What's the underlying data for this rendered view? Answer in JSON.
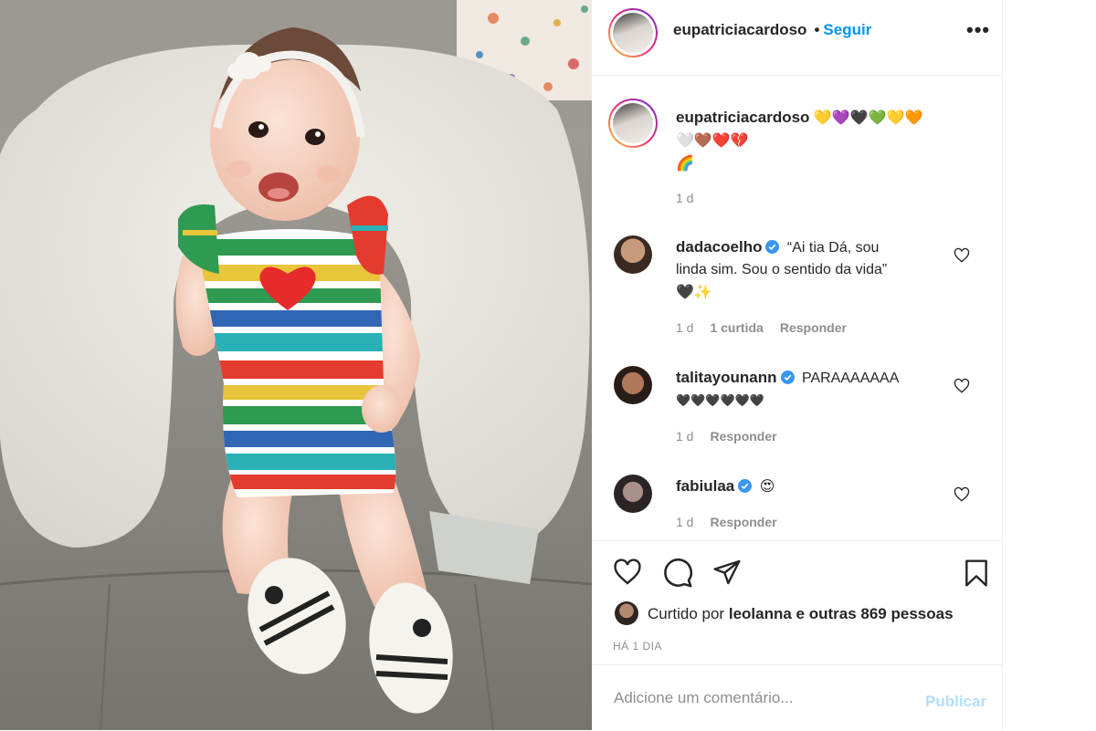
{
  "post": {
    "author": "eupatriciacardoso",
    "separator": "•",
    "follow_label": "Seguir",
    "more_label": "•••",
    "caption": {
      "username": "eupatriciacardoso",
      "line1": "💛💜🖤💚💛🧡",
      "line2": "🤍🤎❤️💔",
      "line3": "🌈",
      "time": "1 d"
    },
    "comments": [
      {
        "username": "dadacoelho",
        "verified": true,
        "text_line1": "“Ai tia Dá, sou",
        "text_line2": "linda sim. Sou o sentido da vida”",
        "text_line3": "🖤✨",
        "time": "1 d",
        "likes": "1 curtida",
        "reply": "Responder"
      },
      {
        "username": "talitayounann",
        "verified": true,
        "text_line1": "PARAAAAAAA",
        "text_line2": "🖤🖤🖤🖤🖤🖤",
        "time": "1 d",
        "reply": "Responder"
      },
      {
        "username": "fabiulaa",
        "verified": true,
        "text_line1": "😍",
        "time": "1 d",
        "reply": "Responder"
      }
    ],
    "likes": {
      "prefix": "Curtido por",
      "user": "leolanna",
      "suffix": "e outras 869 pessoas"
    },
    "date": "HÁ 1 DIA",
    "add_comment": {
      "placeholder": "Adicione um comentário...",
      "publish_label": "Publicar"
    },
    "colors": {
      "accent": "#0095f6",
      "publish_disabled": "#b2dffc",
      "muted": "#8e8e8e",
      "text": "#262626",
      "verified": "#3897f0"
    },
    "icons": [
      "heart-icon",
      "comment-icon",
      "share-icon",
      "bookmark-icon",
      "verified-badge-icon",
      "more-options-icon"
    ]
  }
}
